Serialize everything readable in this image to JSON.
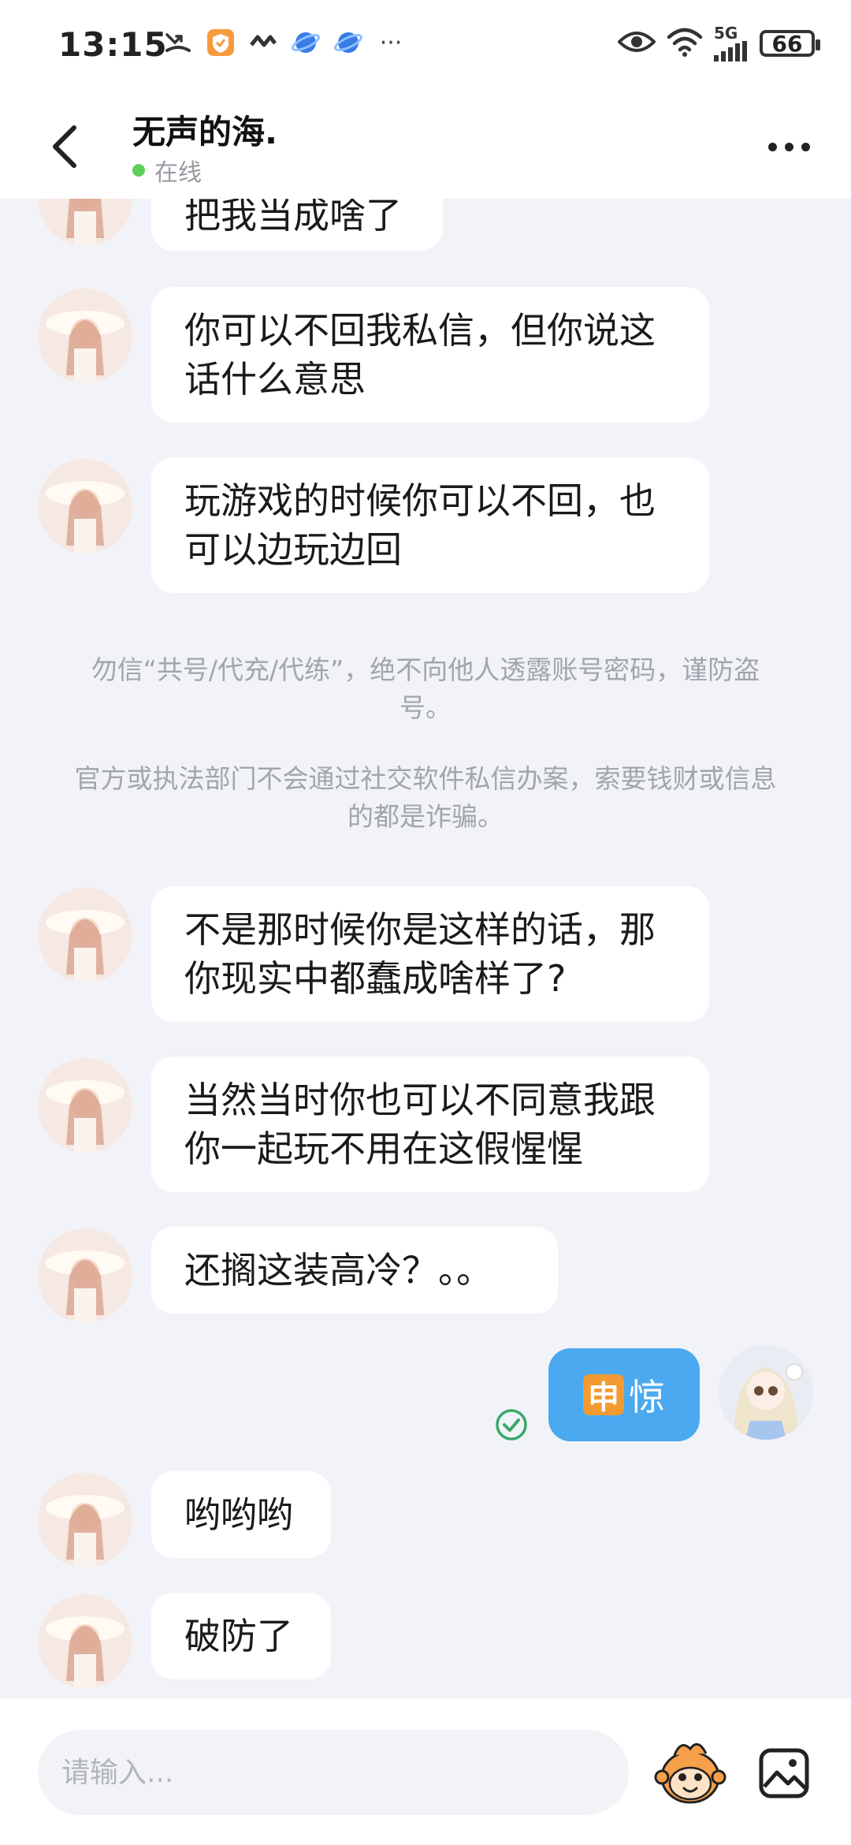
{
  "status_bar": {
    "time": "13:15",
    "network": "5G",
    "battery": "66",
    "overflow": "···",
    "left_icons": [
      "missed-call-icon",
      "app-shield-icon",
      "app-wave-icon",
      "browser-planet-icon",
      "browser-planet-icon",
      "more-notifications-icon"
    ],
    "right_icons": [
      "eye-icon",
      "wifi-icon",
      "signal-icon",
      "battery-icon"
    ]
  },
  "header": {
    "contact_name": "无声的海.",
    "status": "在线",
    "status_color": "#5fcf5a"
  },
  "messages": [
    {
      "from": "them",
      "text": "把我当成啥了"
    },
    {
      "from": "them",
      "text": "你可以不回我私信，但你说这话什么意思"
    },
    {
      "from": "them",
      "text": "玩游戏的时候你可以不回，也可以边玩边回"
    },
    {
      "from": "system",
      "text": "勿信“共号/代充/代练”，绝不向他人透露账号密码，谨防盗号。"
    },
    {
      "from": "system",
      "text": "官方或执法部门不会通过社交软件私信办案，索要钱财或信息的都是诈骗。"
    },
    {
      "from": "them",
      "text": "不是那时候你是这样的话，那你现实中都蠢成啥样了?"
    },
    {
      "from": "them",
      "text": "当然当时你也可以不同意我跟你一起玩不用在这假惺惺"
    },
    {
      "from": "them",
      "text": "还搁这装高冷？。。"
    },
    {
      "from": "me",
      "emoji_char": "申",
      "text": "惊",
      "read": true
    },
    {
      "from": "them",
      "text": "哟哟哟"
    },
    {
      "from": "them",
      "text": "破防了"
    }
  ],
  "input": {
    "placeholder": "请输入..."
  },
  "colors": {
    "background": "#f1f3f9",
    "my_bubble": "#4aa9ef",
    "their_bubble": "#ffffff",
    "notice_text": "#a3a5ad"
  },
  "icons": {
    "back": "back-arrow-icon",
    "more": "more-dots-icon",
    "emoji": "emoji-monkey-icon",
    "image": "image-icon",
    "read": "read-check-icon"
  }
}
